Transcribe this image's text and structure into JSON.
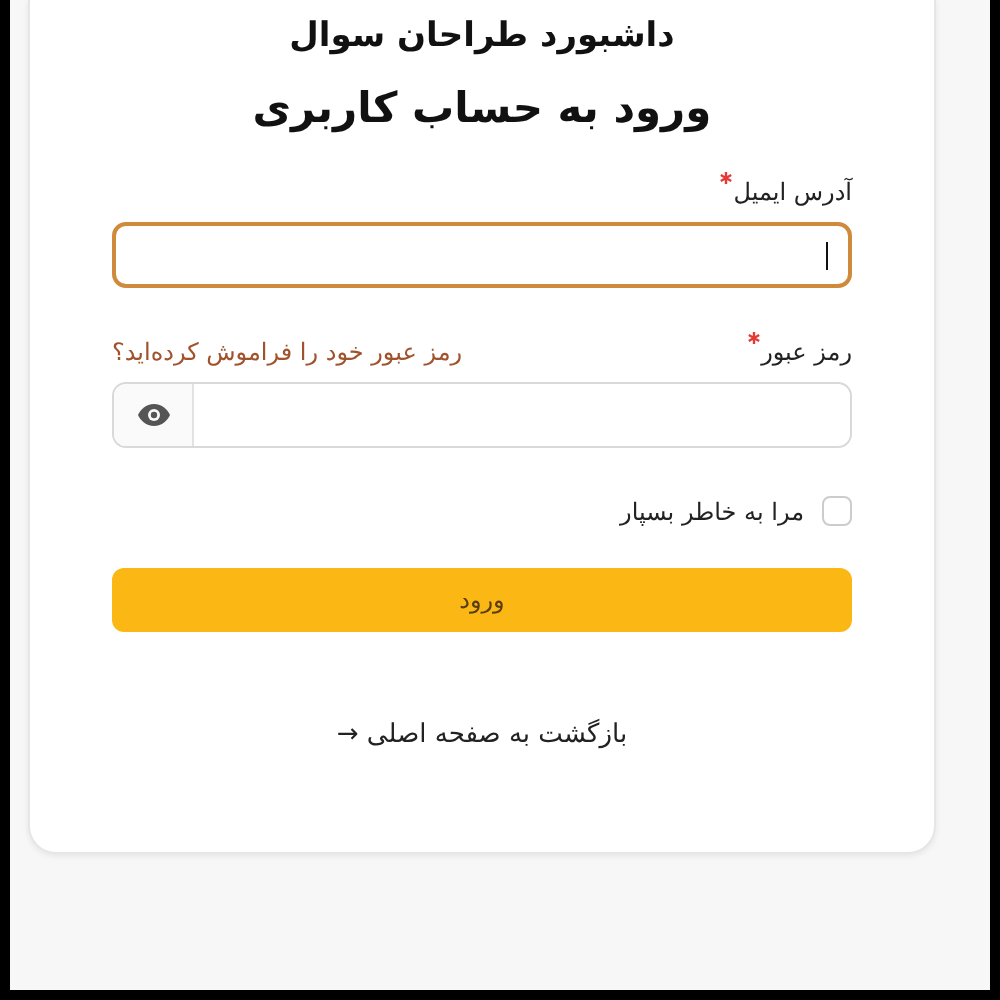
{
  "app_title": "داشبورد طراحان سوال",
  "heading": "ورود به حساب کاربری",
  "email_field": {
    "label": "آدرس ایمیل",
    "required": true,
    "focused": true
  },
  "password_field": {
    "label": "رمز عبور",
    "required": true,
    "focused": false
  },
  "forgot_link": "رمز عبور خود را فراموش کرده‌اید؟",
  "remember_me": {
    "label": "مرا به خاطر بسپار",
    "checked": false
  },
  "submit_button": "ورود",
  "back_link": "بازگشت به صفحه اصلی →"
}
